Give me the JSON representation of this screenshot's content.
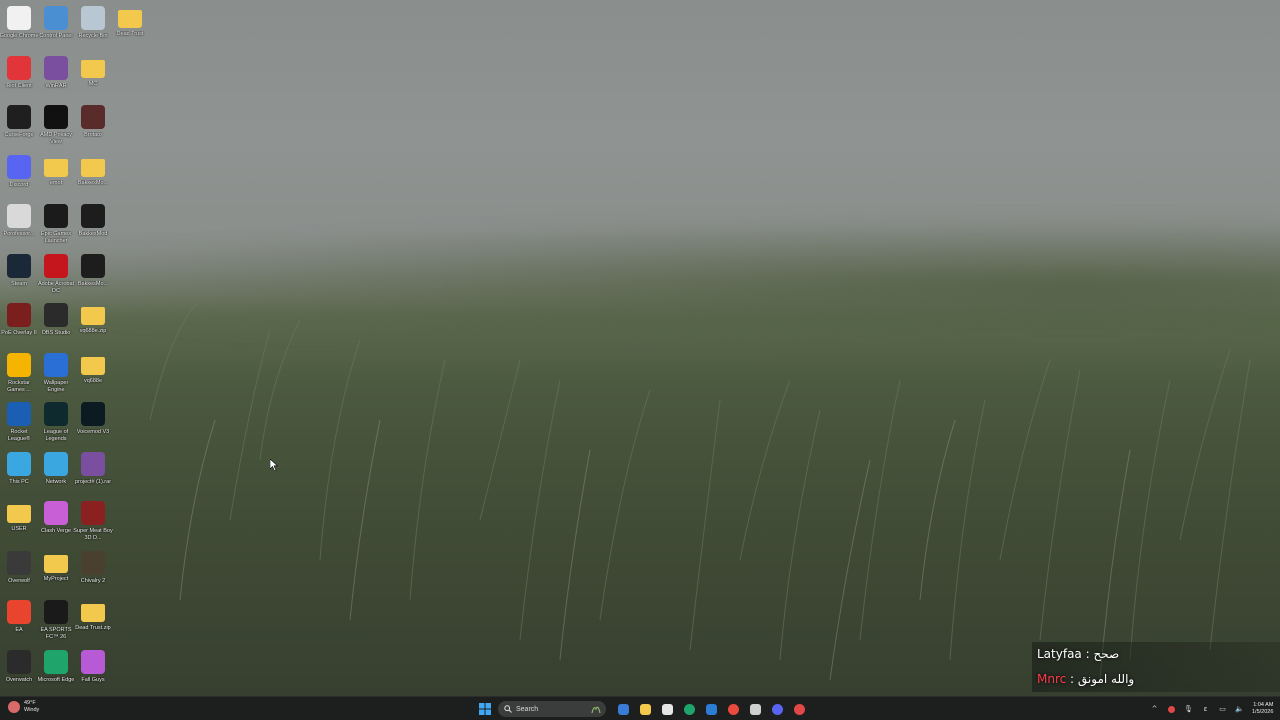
{
  "desktop": {
    "icons": [
      {
        "label": "Google Chrome",
        "icon": "document-icon",
        "color": "#f1f1f1"
      },
      {
        "label": "Control Panel",
        "icon": "control-panel-icon",
        "color": "#4a8fd1"
      },
      {
        "label": "Recycle Bin",
        "icon": "recycle-bin-icon",
        "color": "#b9c7d2"
      },
      {
        "label": "Dead Trust",
        "icon": "folder-icon",
        "color": "#f2c94c"
      },
      {
        "label": "Riot Client",
        "icon": "riot-icon",
        "color": "#e2353a"
      },
      {
        "label": "WinRAR",
        "icon": "winrar-icon",
        "color": "#7b4fa0"
      },
      {
        "label": "MC",
        "icon": "folder-icon",
        "color": "#f2c94c"
      },
      {
        "label": "CurseForge",
        "icon": "curseforge-icon",
        "color": "#1f1f1f"
      },
      {
        "label": "AMD Privacy View",
        "icon": "amd-eye-icon",
        "color": "#111111"
      },
      {
        "label": "Brotato",
        "icon": "brotato-icon",
        "color": "#5a2b2b"
      },
      {
        "label": "Discord",
        "icon": "discord-icon",
        "color": "#5865f2"
      },
      {
        "label": "emot",
        "icon": "folder-icon",
        "color": "#f2c94c"
      },
      {
        "label": "BakkesMo...",
        "icon": "folder-icon",
        "color": "#f2c94c"
      },
      {
        "label": "Porofessor...",
        "icon": "porofessor-icon",
        "color": "#d9d9d9"
      },
      {
        "label": "Epic Games Launcher",
        "icon": "epic-games-icon",
        "color": "#1b1b1b"
      },
      {
        "label": "BakkesMod",
        "icon": "bakkesmod-icon",
        "color": "#1d1d1d"
      },
      {
        "label": "Steam",
        "icon": "steam-icon",
        "color": "#1b2838"
      },
      {
        "label": "Adobe Acrobat DC",
        "icon": "acrobat-icon",
        "color": "#c4161c"
      },
      {
        "label": "BakkesMo...",
        "icon": "bakkesmod-icon",
        "color": "#1d1d1d"
      },
      {
        "label": "PoE Overlay II",
        "icon": "poe-overlay-icon",
        "color": "#7a1e1e"
      },
      {
        "label": "OBS Studio",
        "icon": "obs-icon",
        "color": "#2b2b2b"
      },
      {
        "label": "vq688e.zip",
        "icon": "zip-folder-icon",
        "color": "#f2c94c"
      },
      {
        "label": "Rockstar Games ...",
        "icon": "rockstar-icon",
        "color": "#f5b400"
      },
      {
        "label": "Wallpaper Engine",
        "icon": "wallpaper-engine-icon",
        "color": "#2a6fd6"
      },
      {
        "label": "vq688e",
        "icon": "folder-icon",
        "color": "#f2c94c"
      },
      {
        "label": "Rocket League®",
        "icon": "rocket-league-icon",
        "color": "#1a5fb4"
      },
      {
        "label": "League of Legends",
        "icon": "league-icon",
        "color": "#0f2a2f"
      },
      {
        "label": "Voicemod V3",
        "icon": "voicemod-icon",
        "color": "#0c1b22"
      },
      {
        "label": "This PC",
        "icon": "monitor-icon",
        "color": "#3aa7e0"
      },
      {
        "label": "Network",
        "icon": "network-icon",
        "color": "#3aa7e0"
      },
      {
        "label": "project# (1).rar",
        "icon": "rar-archive-icon",
        "color": "#7b4fa0"
      },
      {
        "label": "USER",
        "icon": "folder-icon",
        "color": "#f2c94c"
      },
      {
        "label": "Clash Verge",
        "icon": "clash-verge-icon",
        "color": "#c95fd6"
      },
      {
        "label": "Super Meat Boy 3D D...",
        "icon": "super-meat-boy-icon",
        "color": "#8a2020"
      },
      {
        "label": "Overwolf",
        "icon": "overwolf-icon",
        "color": "#3a3a3a"
      },
      {
        "label": "MyProject",
        "icon": "folder-icon",
        "color": "#f2c94c"
      },
      {
        "label": "Chivalry 2",
        "icon": "chivalry-icon",
        "color": "#4a4030"
      },
      {
        "label": "EA",
        "icon": "ea-icon",
        "color": "#e8442e"
      },
      {
        "label": "EA SPORTS FC™ 26",
        "icon": "ea-fc-icon",
        "color": "#1a1a1a"
      },
      {
        "label": "Dead Trust.zip",
        "icon": "zip-folder-icon",
        "color": "#f2c94c"
      },
      {
        "label": "Overwatch",
        "icon": "overwatch-icon",
        "color": "#2b2b2b"
      },
      {
        "label": "Microsoft Edge",
        "icon": "edge-icon",
        "color": "#1fa56b"
      },
      {
        "label": "Fall Guys",
        "icon": "fall-guys-icon",
        "color": "#b85ad6"
      }
    ]
  },
  "chat": {
    "line1": {
      "name": "Latyfaa",
      "message": "صحح"
    },
    "line2": {
      "name": "Mnrc",
      "message": "والله امونق"
    },
    "separator": " : ",
    "name_color_red": "#ff3a4a"
  },
  "taskbar": {
    "weather": {
      "temp": "49°F",
      "condition": "Windy"
    },
    "search_placeholder": "Search",
    "apps": [
      {
        "name": "copilot-icon",
        "color": "#3a7bd5"
      },
      {
        "name": "file-explorer-icon",
        "color": "#f2c94c"
      },
      {
        "name": "microsoft-store-icon",
        "color": "#e6e6e6"
      },
      {
        "name": "edge-icon",
        "color": "#1fa56b"
      },
      {
        "name": "outlook-icon",
        "color": "#2b7cd3"
      },
      {
        "name": "chrome-icon",
        "color": "#e84a3d"
      },
      {
        "name": "snipping-tool-icon",
        "color": "#d0d0d0"
      },
      {
        "name": "discord-icon",
        "color": "#5865f2"
      },
      {
        "name": "recording-icon",
        "color": "#e34848"
      }
    ],
    "clock": {
      "time": "1:04 AM",
      "date": "1/5/2026"
    }
  }
}
